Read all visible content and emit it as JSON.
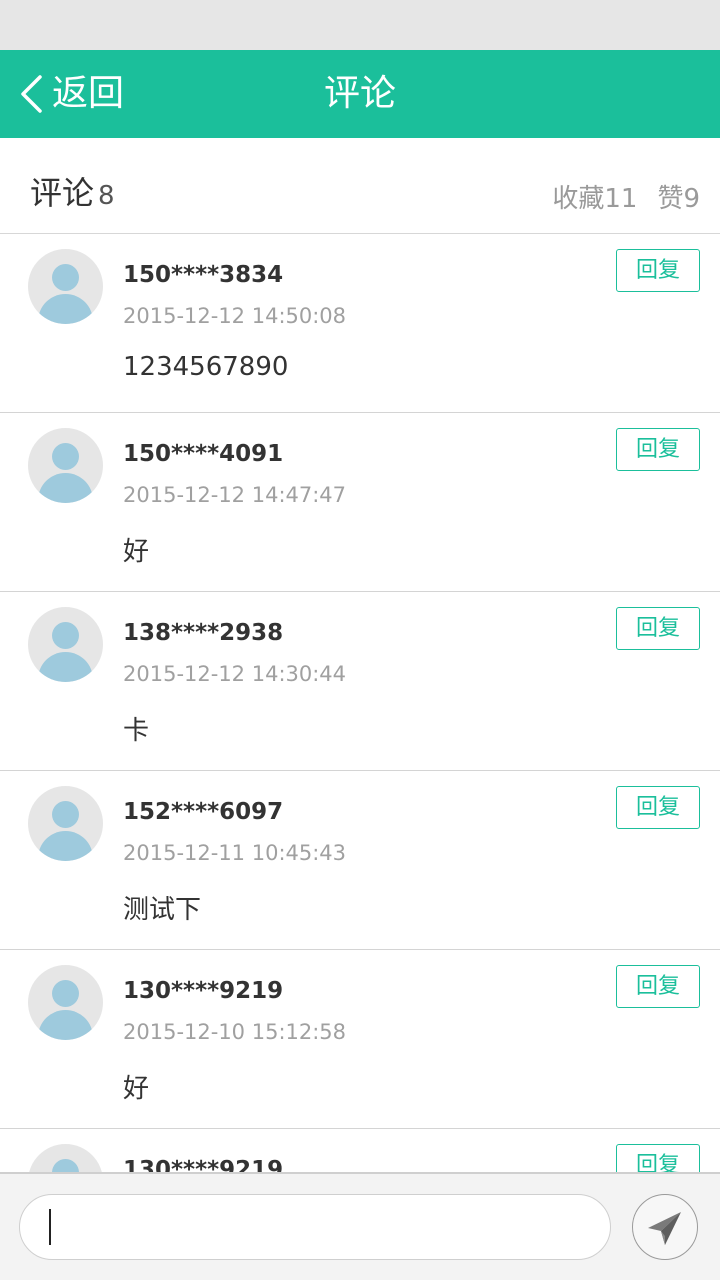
{
  "header": {
    "back_label": "返回",
    "title": "评论"
  },
  "summary": {
    "label": "评论",
    "count": "8",
    "favorites": "收藏11",
    "likes": "赞9"
  },
  "reply_label": "回复",
  "comments": [
    {
      "user": "150****3834",
      "time": "2015-12-12 14:50:08",
      "text": "1234567890"
    },
    {
      "user": "150****4091",
      "time": "2015-12-12 14:47:47",
      "text": "好"
    },
    {
      "user": "138****2938",
      "time": "2015-12-12 14:30:44",
      "text": "卡"
    },
    {
      "user": "152****6097",
      "time": "2015-12-11 10:45:43",
      "text": "测试下"
    },
    {
      "user": "130****9219",
      "time": "2015-12-10 15:12:58",
      "text": "好"
    },
    {
      "user": "130****9219",
      "time": "",
      "text": ""
    }
  ],
  "input": {
    "placeholder": ""
  },
  "colors": {
    "accent": "#1bbf9b",
    "avatar_fill": "#9ecadd"
  },
  "icons": {
    "back": "chevron-left-icon",
    "send": "paper-plane-icon",
    "avatar": "default-user-icon"
  }
}
